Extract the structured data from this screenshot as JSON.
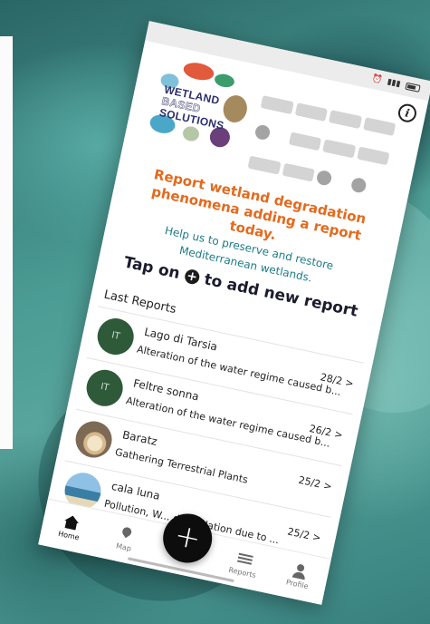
{
  "status_bar": {
    "icons": [
      "alarm-icon",
      "signal-icon",
      "battery-icon"
    ]
  },
  "header": {
    "info_icon": "info-icon",
    "logo_lines": [
      "WETLAND",
      "BASED",
      "SOLUTIONS"
    ]
  },
  "intro": {
    "headline": "Report wetland degradation phenomena adding a report today.",
    "subtitle_line1": "Help us to preserve and restore",
    "subtitle_line2": "Mediterranean wetlands.",
    "tap_prefix": "Tap on",
    "tap_suffix": "to add new report"
  },
  "reports": {
    "section_title": "Last Reports",
    "items": [
      {
        "avatar_text": "IT",
        "title": "Lago di Tarsia",
        "description": "Alteration of the water regime caused b...",
        "date": "28/2 >"
      },
      {
        "avatar_text": "IT",
        "title": "Feltre sonna",
        "description": "Alteration of the water regime caused b...",
        "date": "26/2 >"
      },
      {
        "avatar_text": "",
        "title": "Baratz",
        "description": "Gathering Terrestrial Plants",
        "date": "25/2 >"
      },
      {
        "avatar_text": "",
        "title": "cala luna",
        "description": "Pollution, W... degradation due to ...",
        "date": "25/2 >"
      }
    ]
  },
  "tabbar": {
    "home": "Home",
    "map": "Map",
    "reports": "Reports",
    "profile": "Profile",
    "fab": "+"
  },
  "colors": {
    "headline": "#e46a1d",
    "subtitle": "#1d7c86",
    "avatar": "#2f5a3a"
  }
}
